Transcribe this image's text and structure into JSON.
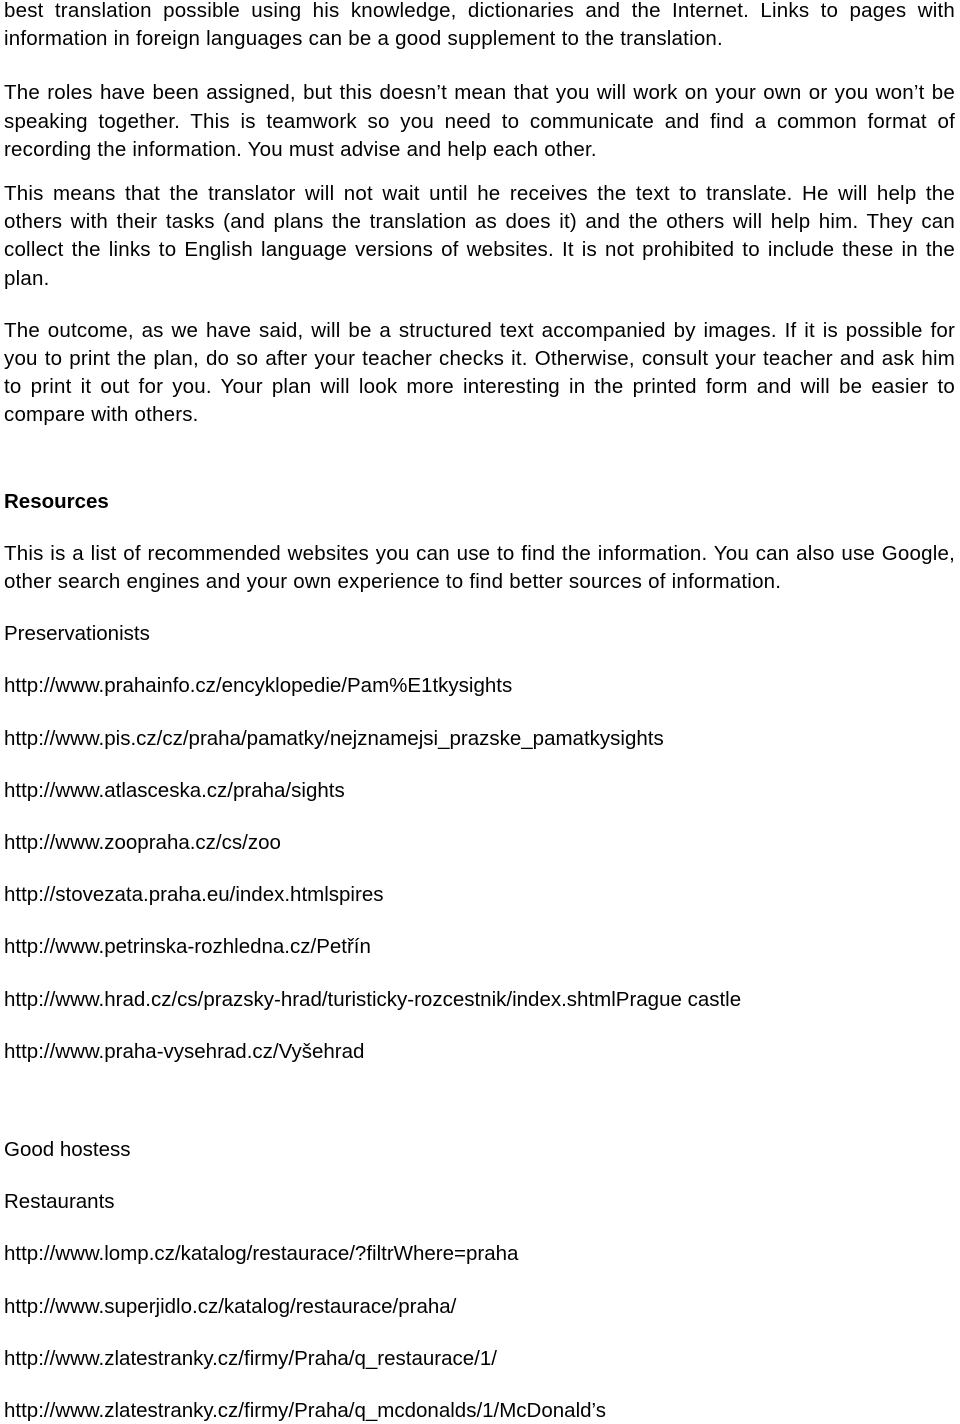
{
  "document": {
    "body_paragraphs": [
      "best translation possible using his knowledge, dictionaries and the Internet. Links to pages with information in foreign languages can be a good supplement to the translation.",
      "The roles have been assigned, but this doesn’t mean that you will work on your own or you won’t be speaking together. This is teamwork so you need to communicate and find a common format of recording the information. You must advise and help each other.",
      "This means that the translator will not wait until he receives the text to translate. He will help the others with their tasks (and plans the translation as does it) and the others will help him. They can collect the links to English language versions of websites. It is not prohibited to include these in the plan.",
      "The outcome, as we have said, will be a structured text accompanied by images. If it is possible for you to print the plan, do so after your teacher checks it. Otherwise, consult your teacher and ask him to print it out for you. Your plan will look more interesting in the printed form and will be easier to compare with others."
    ],
    "resources": {
      "heading": "Resources",
      "intro": "This is a list of recommended websites you can use to find the information. You can also use Google, other search engines and your own experience to find better sources of information.",
      "sections": [
        {
          "title": "Preservationists",
          "links": [
            {
              "url": "http://www.prahainfo.cz/encyklopedie/Pam%E1tky",
              "label": "sights"
            },
            {
              "url": "http://www.pis.cz/cz/praha/pamatky/nejznamejsi_prazske_pamatky",
              "label": "sights"
            },
            {
              "url": "http://www.atlasceska.cz/praha/",
              "label": "sights"
            },
            {
              "url": "http://www.zoopraha.cz/cs/",
              "label": "zoo"
            },
            {
              "url": "http://stovezata.praha.eu/index.html",
              "label": "spires"
            },
            {
              "url": "http://www.petrinska-rozhledna.cz/",
              "label": "Petřín"
            },
            {
              "url": "http://www.hrad.cz/cs/prazsky-hrad/turisticky-rozcestnik/index.shtml",
              "label": "Prague castle"
            },
            {
              "url": "http://www.praha-vysehrad.cz/",
              "label": "Vyšehrad"
            }
          ]
        },
        {
          "title": "Good hostess",
          "subtitle": "Restaurants",
          "links": [
            {
              "url": "http://www.lomp.cz/katalog/restaurace/?filtrWhere=praha",
              "label": ""
            },
            {
              "url": "http://www.superjidlo.cz/katalog/restaurace/praha/",
              "label": ""
            },
            {
              "url": "http://www.zlatestranky.cz/firmy/Praha/q_restaurace/1/",
              "label": ""
            },
            {
              "url": "http://www.zlatestranky.cz/firmy/Praha/q_mcdonalds/1/",
              "label": "McDonald’s"
            }
          ]
        }
      ]
    }
  }
}
